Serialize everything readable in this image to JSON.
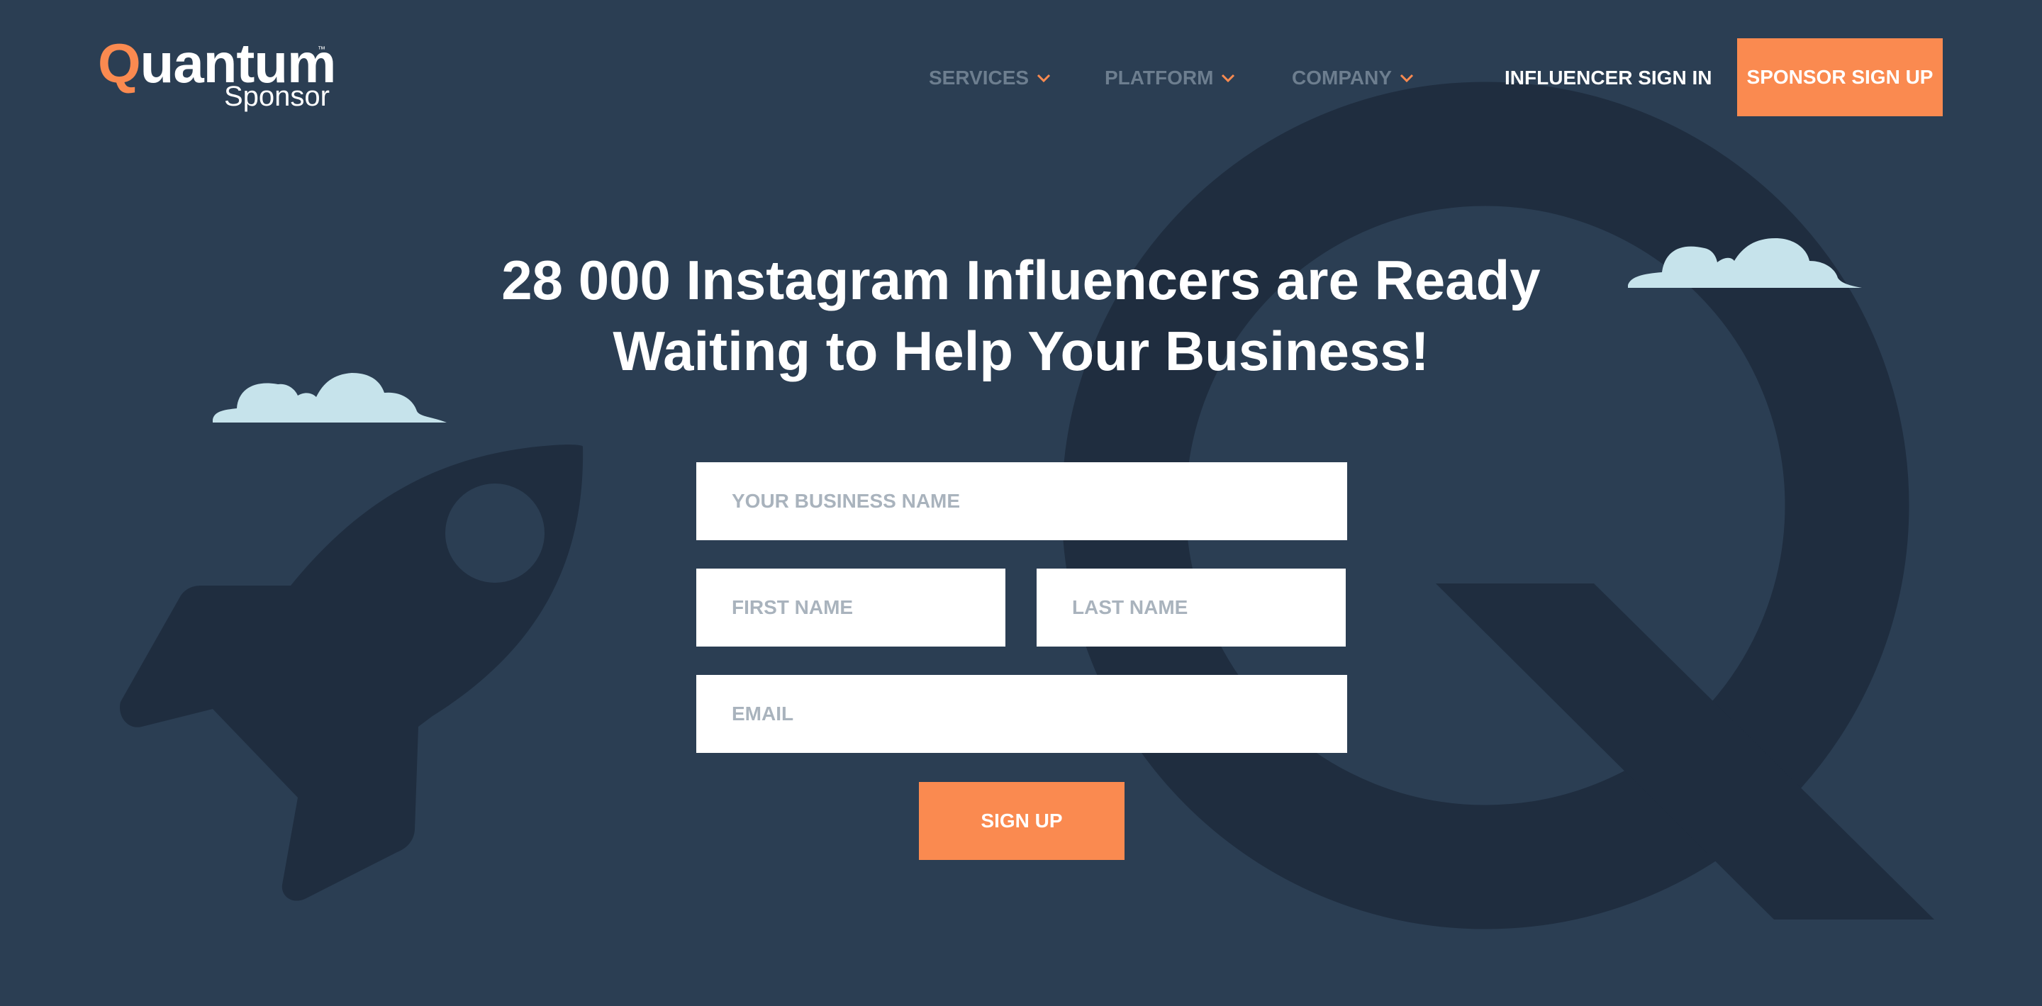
{
  "brand": {
    "name_q": "Q",
    "name_rest": "uantum",
    "sub": "Sponsor",
    "tm": "™",
    "accent_color": "#fa8a50",
    "background_color": "#2b3e53"
  },
  "nav": {
    "items": [
      {
        "label": "SERVICES",
        "icon": "chevron-down-icon"
      },
      {
        "label": "PLATFORM",
        "icon": "chevron-down-icon"
      },
      {
        "label": "COMPANY",
        "icon": "chevron-down-icon"
      }
    ],
    "signin_label": "INFLUENCER SIGN IN",
    "sponsor_label": "SPONSOR SIGN UP"
  },
  "hero": {
    "title_line1": "28 000 Instagram Influencers are Ready",
    "title_line2": "Waiting to Help Your Business!"
  },
  "form": {
    "business_placeholder": "YOUR BUSINESS NAME",
    "first_placeholder": "FIRST NAME",
    "last_placeholder": "LAST NAME",
    "email_placeholder": "EMAIL",
    "submit_label": "SIGN UP"
  },
  "decor": {
    "background_icons": [
      "large-q-logo-icon",
      "rocket-icon",
      "cloud-icon"
    ]
  }
}
